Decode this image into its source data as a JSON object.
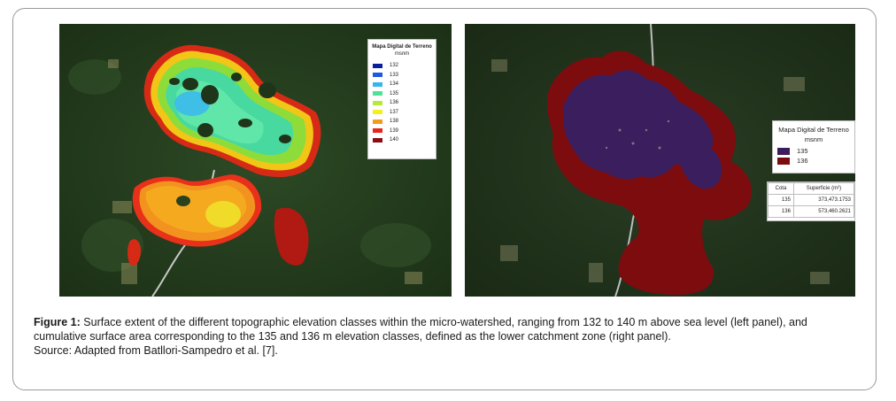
{
  "figure": {
    "label": "Figure 1:",
    "caption": "Surface extent of the different topographic elevation classes within the micro-watershed, ranging from 132 to 140 m above sea level (left panel), and cumulative surface area corresponding to the 135 and 136 m elevation classes, defined as the lower catchment zone (right panel).",
    "source": "Source: Adapted from Batllori-Sampedro et al. [7]."
  },
  "left_map": {
    "legend_title": "Mapa Digital de Terreno",
    "legend_unit": "msnm",
    "classes": [
      {
        "label": "132",
        "color": "#0a1f9e"
      },
      {
        "label": "133",
        "color": "#1c5ae0"
      },
      {
        "label": "134",
        "color": "#35b6ee"
      },
      {
        "label": "135",
        "color": "#4fe39a"
      },
      {
        "label": "136",
        "color": "#b6ea36"
      },
      {
        "label": "137",
        "color": "#f4ef1e"
      },
      {
        "label": "138",
        "color": "#f59a1f"
      },
      {
        "label": "139",
        "color": "#e8251a"
      },
      {
        "label": "140",
        "color": "#8a0d10"
      }
    ]
  },
  "right_map": {
    "legend_title": "Mapa Digital de Terreno",
    "legend_unit": "msnm",
    "classes": [
      {
        "label": "135",
        "color": "#3a1d5a"
      },
      {
        "label": "136",
        "color": "#7a0c0e"
      }
    ],
    "table": {
      "headers": [
        "Cota",
        "Superficie (m²)"
      ],
      "rows": [
        [
          "135",
          "373,473.1753"
        ],
        [
          "136",
          "573,460.2621"
        ]
      ]
    }
  }
}
